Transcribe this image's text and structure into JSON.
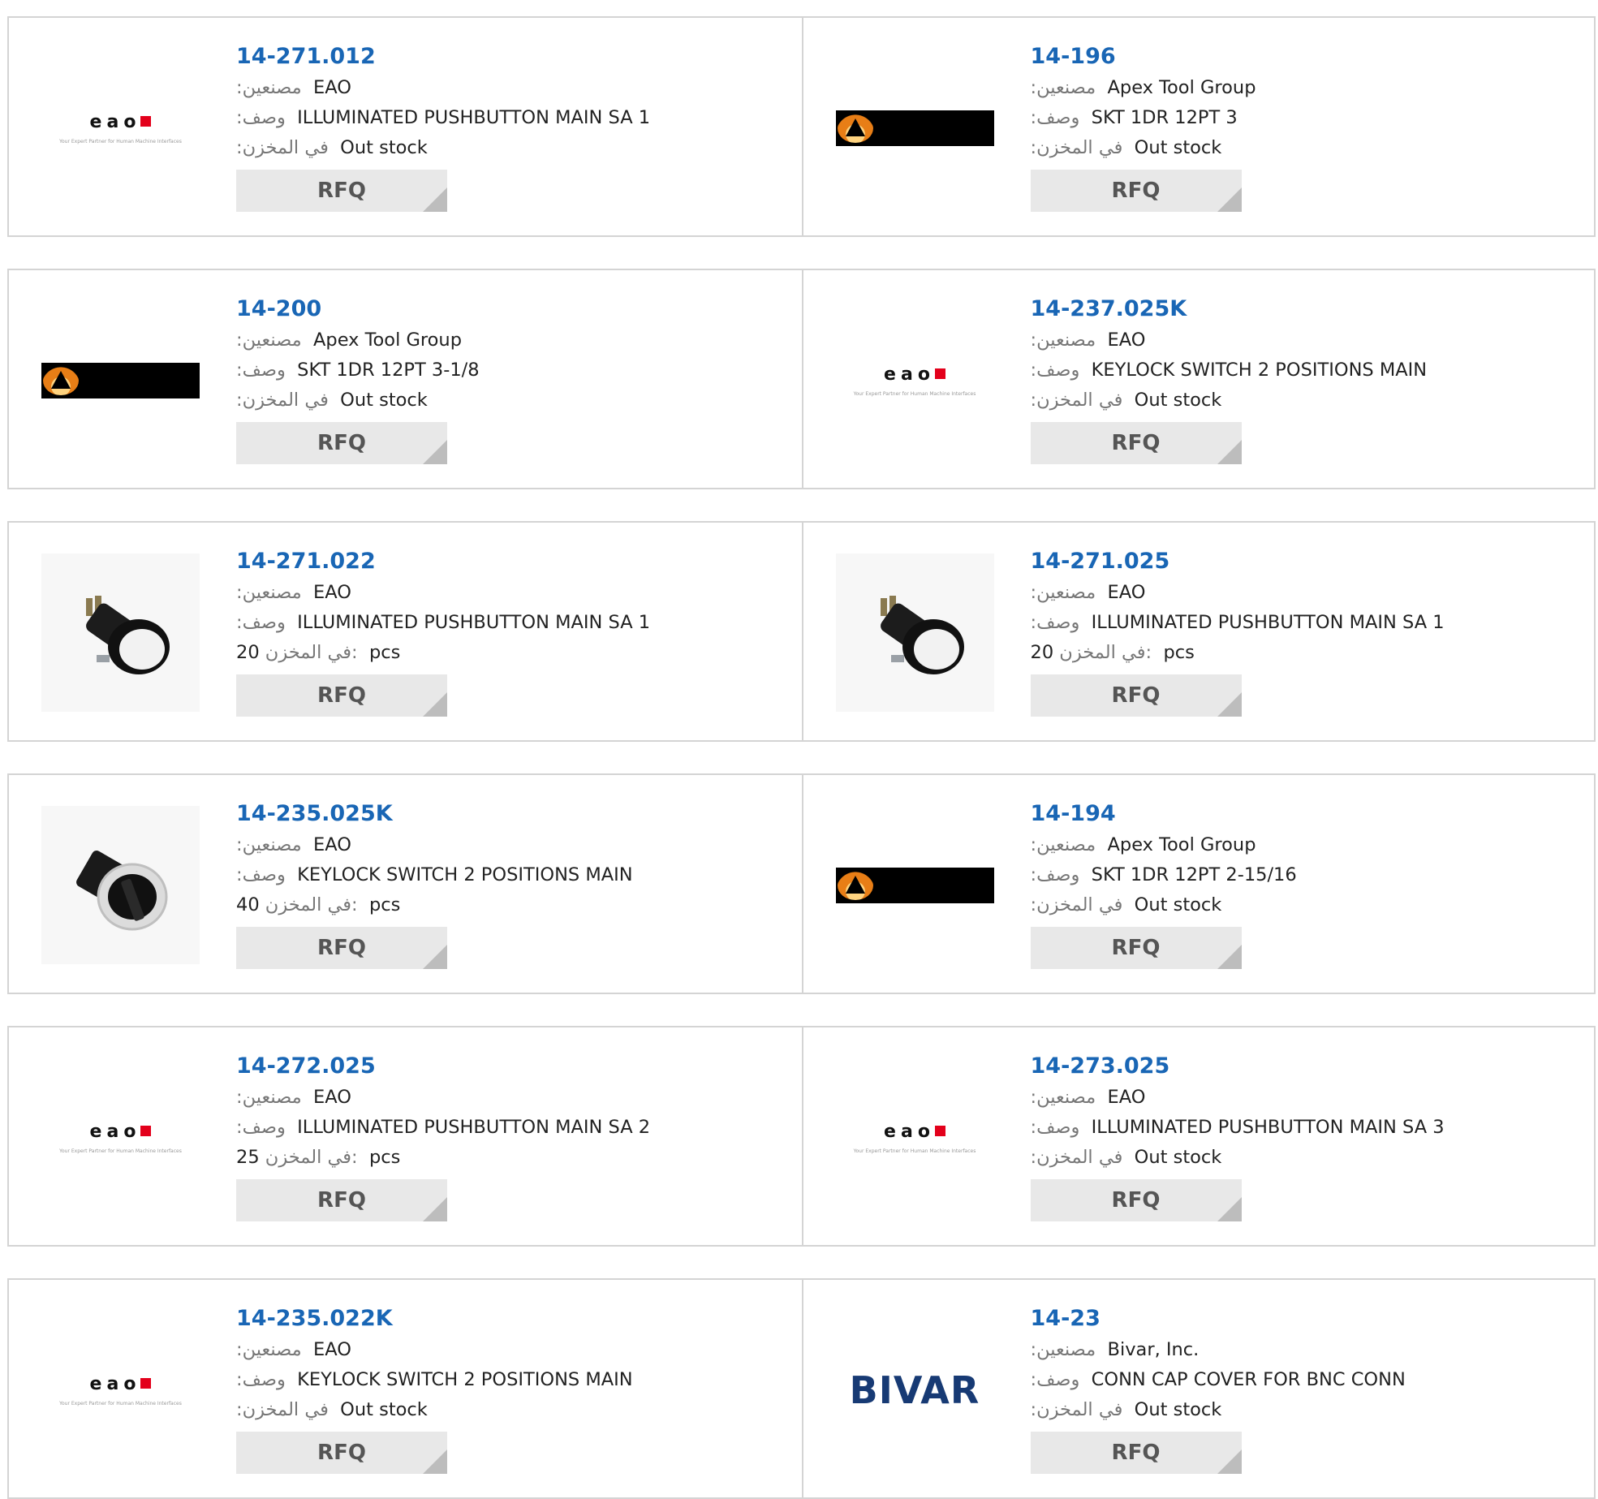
{
  "labels": {
    "manufacturer": ":مصنعين",
    "description": ":وصف",
    "stock": ":في المخزن",
    "stock_qty": "في المخزن:",
    "pcs": "pcs",
    "rfq": "RFQ"
  },
  "eao_tagline": "Your Expert Partner for Human Machine Interfaces",
  "bivar_word": "BIVAR",
  "products": [
    {
      "part": "14-271.012",
      "maker": "EAO",
      "desc": "ILLUMINATED PUSHBUTTON MAIN SA 1",
      "stock": "Out stock",
      "qty": null,
      "image": "eao-logo"
    },
    {
      "part": "14-196",
      "maker": "Apex Tool Group",
      "desc": "SKT 1DR 12PT 3",
      "stock": "Out stock",
      "qty": null,
      "image": "apex-logo"
    },
    {
      "part": "14-200",
      "maker": "Apex Tool Group",
      "desc": "SKT 1DR 12PT 3-1/8",
      "stock": "Out stock",
      "qty": null,
      "image": "apex-logo"
    },
    {
      "part": "14-237.025K",
      "maker": "EAO",
      "desc": "KEYLOCK SWITCH 2 POSITIONS MAIN",
      "stock": "Out stock",
      "qty": null,
      "image": "eao-logo"
    },
    {
      "part": "14-271.022",
      "maker": "EAO",
      "desc": "ILLUMINATED PUSHBUTTON MAIN SA 1",
      "stock": null,
      "qty": "20",
      "image": "pushbutton-photo"
    },
    {
      "part": "14-271.025",
      "maker": "EAO",
      "desc": "ILLUMINATED PUSHBUTTON MAIN SA 1",
      "stock": null,
      "qty": "20",
      "image": "pushbutton-photo"
    },
    {
      "part": "14-235.025K",
      "maker": "EAO",
      "desc": "KEYLOCK SWITCH 2 POSITIONS MAIN",
      "stock": null,
      "qty": "40",
      "image": "selector-switch-photo"
    },
    {
      "part": "14-194",
      "maker": "Apex Tool Group",
      "desc": "SKT 1DR 12PT 2-15/16",
      "stock": "Out stock",
      "qty": null,
      "image": "apex-logo"
    },
    {
      "part": "14-272.025",
      "maker": "EAO",
      "desc": "ILLUMINATED PUSHBUTTON MAIN SA 2",
      "stock": null,
      "qty": "25",
      "image": "eao-logo"
    },
    {
      "part": "14-273.025",
      "maker": "EAO",
      "desc": "ILLUMINATED PUSHBUTTON MAIN SA 3",
      "stock": "Out stock",
      "qty": null,
      "image": "eao-logo"
    },
    {
      "part": "14-235.022K",
      "maker": "EAO",
      "desc": "KEYLOCK SWITCH 2 POSITIONS MAIN",
      "stock": "Out stock",
      "qty": null,
      "image": "eao-logo"
    },
    {
      "part": "14-23",
      "maker": "Bivar, Inc.",
      "desc": "CONN CAP COVER FOR BNC CONN",
      "stock": "Out stock",
      "qty": null,
      "image": "bivar-logo"
    }
  ]
}
